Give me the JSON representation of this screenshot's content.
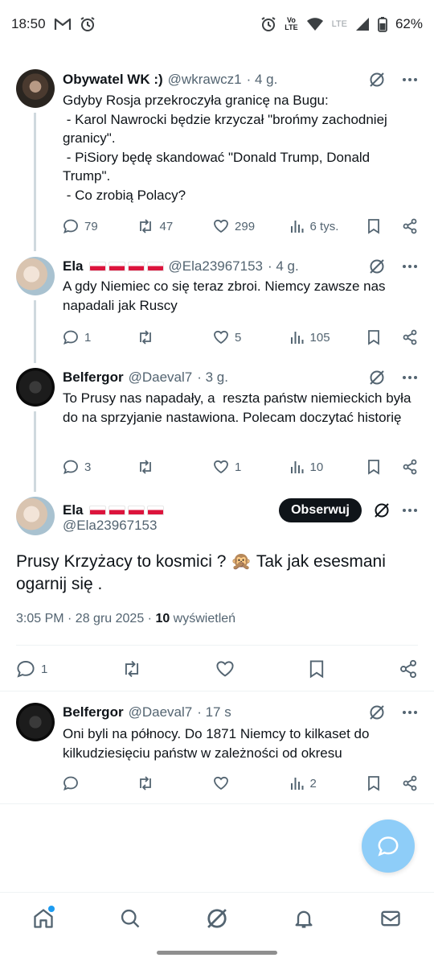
{
  "status_bar": {
    "time": "18:50",
    "volte_top": "Vo",
    "volte_bottom": "LTE",
    "lte": "LTE",
    "battery": "62%"
  },
  "tweets": [
    {
      "name": "Obywatel WK :)",
      "handle": "@wkrawcz1",
      "time": "· 4 g.",
      "text": "Gdyby Rosja przekroczyła granicę na Bugu:\n - Karol Nawrocki będzie krzyczał \"brońmy zachodniej granicy\".\n - PiSiory będę skandować \"Donald Trump, Donald Trump\".\n - Co zrobią Polacy?",
      "replies": "79",
      "reposts": "47",
      "likes": "299",
      "views": "6 tys."
    },
    {
      "name": "Ela",
      "handle": "@Ela23967153",
      "time": "· 4 g.",
      "text": "A gdy Niemiec co się teraz zbroi. Niemcy zawsze nas napadali jak Ruscy",
      "replies": "1",
      "reposts": "",
      "likes": "5",
      "views": "105"
    },
    {
      "name": "Belfergor",
      "handle": "@Daeval7",
      "time": "· 3 g.",
      "text": "To Prusy nas napadały, a  reszta państw niemieckich była do na sprzyjanie nastawiona. Polecam doczytać historię",
      "replies": "3",
      "reposts": "",
      "likes": "1",
      "views": "10"
    }
  ],
  "main_tweet": {
    "name": "Ela",
    "handle": "@Ela23967153",
    "follow_label": "Obserwuj",
    "text": "Prusy Krzyżacy to kosmici ? 🙊 Tak jak esesmani ogarnij się .",
    "datetime": "3:05 PM · 28 gru 2025 · ",
    "views_count": "10",
    "views_label": " wyświetleń",
    "replies": "1"
  },
  "reply": {
    "name": "Belfergor",
    "handle": "@Daeval7",
    "time": "· 17 s",
    "text": "Oni byli na północy. Do 1871 Niemcy to kilkaset do kilkudziesięciu państw w zależności od okresu",
    "views": "2"
  },
  "colors": {
    "text": "#0f1419",
    "secondary": "#536471",
    "accent": "#1d9bf0",
    "fab": "#8ecdf8",
    "flag_red": "#dc143c"
  },
  "nav": [
    "home-icon",
    "search-icon",
    "grok-icon",
    "notifications-icon",
    "messages-icon"
  ]
}
